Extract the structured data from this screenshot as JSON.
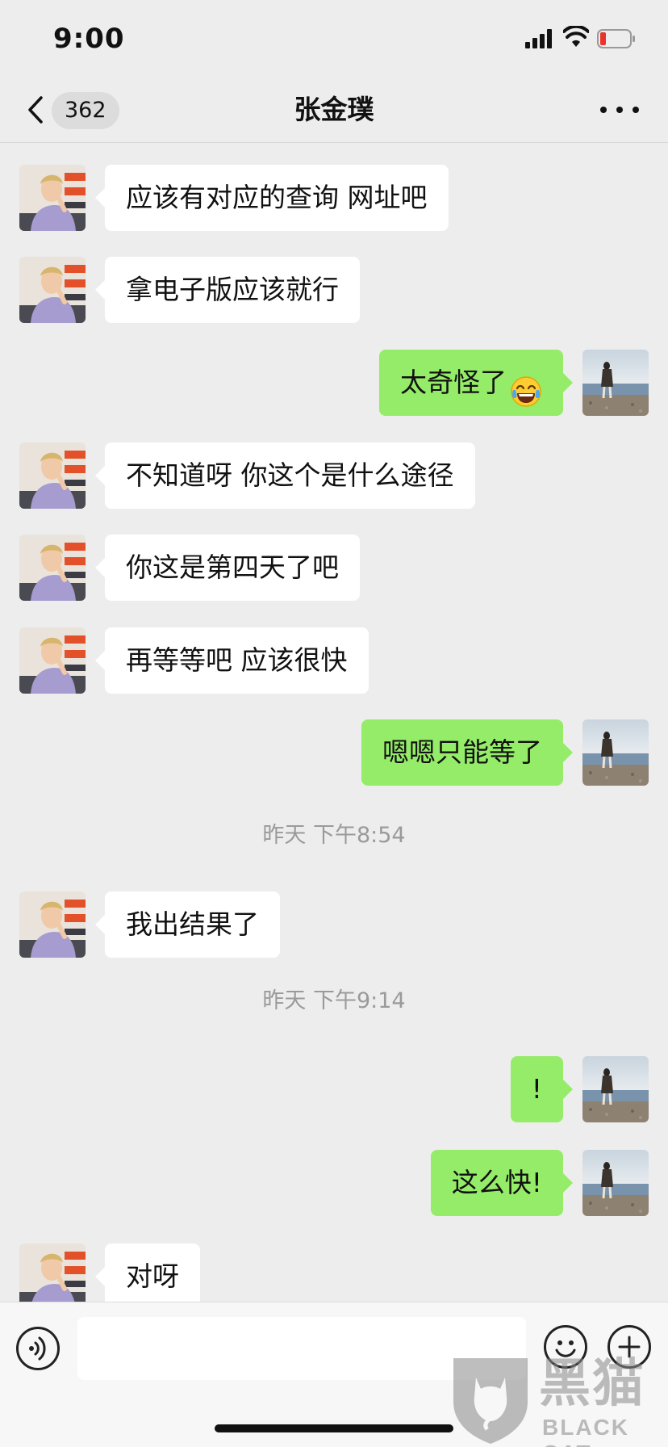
{
  "status_bar": {
    "time": "9:00"
  },
  "header": {
    "back_badge": "362",
    "title": "张金璞"
  },
  "messages": [
    {
      "side": "in",
      "text": "应该有对应的查询 网址吧"
    },
    {
      "side": "in",
      "text": "拿电子版应该就行"
    },
    {
      "side": "out",
      "text": "太奇怪了",
      "emoji": "tears-of-joy-emoji"
    },
    {
      "side": "in",
      "text": "不知道呀 你这个是什么途径"
    },
    {
      "side": "in",
      "text": "你这是第四天了吧"
    },
    {
      "side": "in",
      "text": "再等等吧 应该很快"
    },
    {
      "side": "out",
      "text": "嗯嗯只能等了"
    },
    {
      "type": "time",
      "text": "昨天 下午8:54"
    },
    {
      "side": "in",
      "text": "我出结果了"
    },
    {
      "type": "time",
      "text": "昨天 下午9:14"
    },
    {
      "side": "out",
      "text": "!"
    },
    {
      "side": "out",
      "text": "这么快!"
    },
    {
      "side": "in",
      "text": "对呀"
    }
  ],
  "input_bar": {
    "placeholder": "",
    "icons": [
      "voice-icon",
      "emoji-icon",
      "plus-icon"
    ]
  },
  "watermark": {
    "cn": "黑猫",
    "en": "BLACK CAT"
  },
  "colors": {
    "background": "#ededed",
    "outgoing_bubble": "#95ec69",
    "incoming_bubble": "#ffffff",
    "timestamp": "#9a9a9a"
  }
}
